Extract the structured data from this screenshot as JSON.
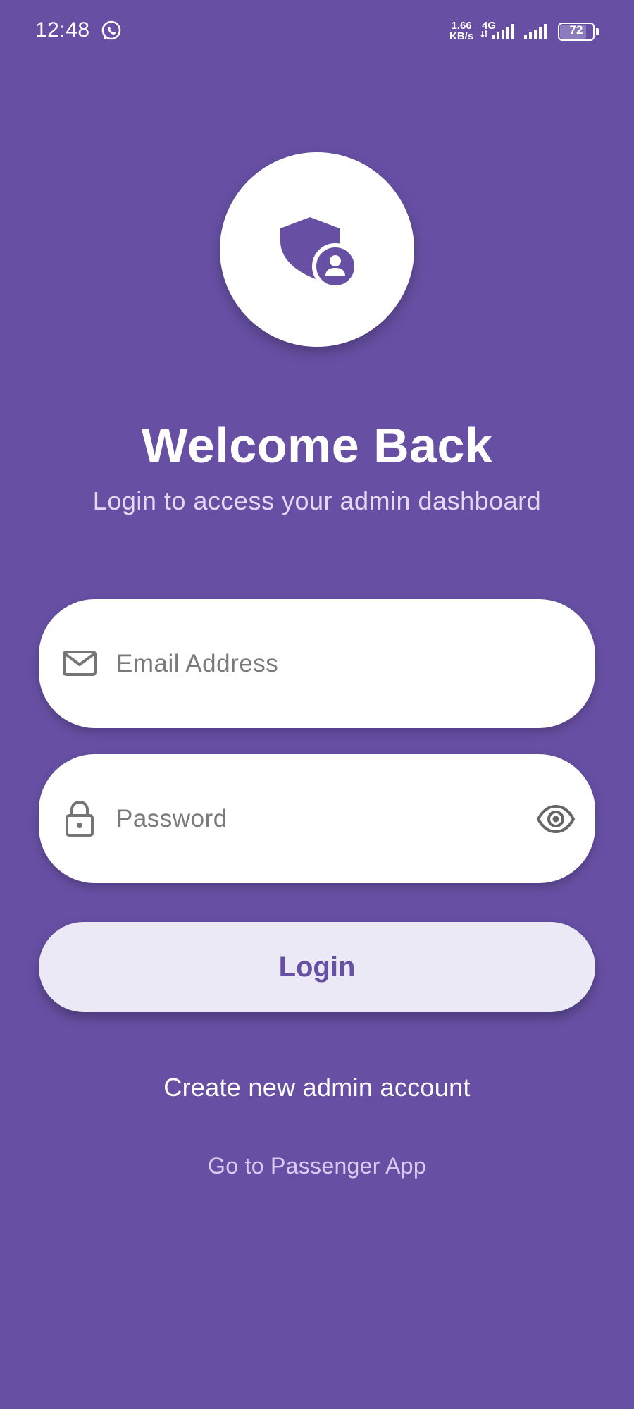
{
  "status_bar": {
    "time": "12:48",
    "net_speed_value": "1.66",
    "net_speed_unit": "KB/s",
    "network_type": "4G",
    "battery_level": "72",
    "notification_icon": "whatsapp-icon"
  },
  "logo": {
    "icon": "admin-shield-icon"
  },
  "header": {
    "title": "Welcome Back",
    "subtitle": "Login to access your admin dashboard"
  },
  "form": {
    "email": {
      "placeholder": "Email Address",
      "value": "",
      "icon": "mail-icon"
    },
    "password": {
      "placeholder": "Password",
      "value": "",
      "icon": "lock-icon",
      "toggle_icon": "eye-icon"
    },
    "login_label": "Login"
  },
  "links": {
    "create_account": "Create new admin account",
    "passenger_app": "Go to Passenger App"
  },
  "colors": {
    "background": "#6750A4",
    "button_bg": "#ECE9F6",
    "accent": "#6750A4",
    "icon_gray": "#757575"
  }
}
